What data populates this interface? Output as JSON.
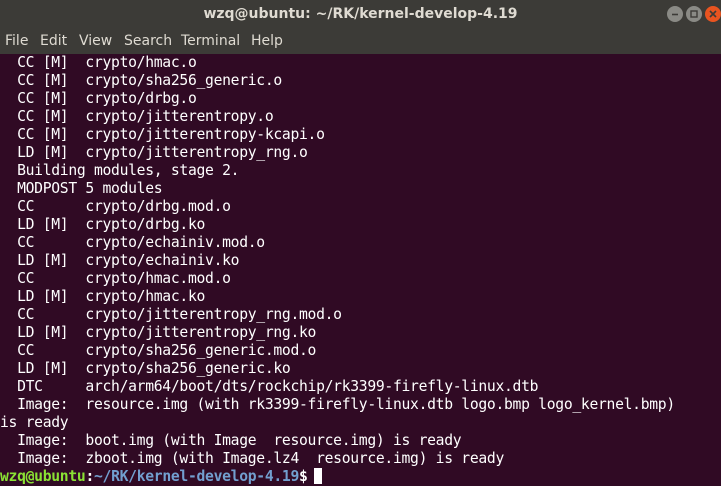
{
  "window": {
    "title": "wzq@ubuntu: ~/RK/kernel-develop-4.19",
    "controls": [
      "minimize",
      "maximize",
      "close"
    ]
  },
  "menu": {
    "file": "File",
    "edit": "Edit",
    "view": "View",
    "search": "Search",
    "terminal": "Terminal",
    "help": "Help"
  },
  "output_lines": [
    "  CC [M]  crypto/hmac.o",
    "  CC [M]  crypto/sha256_generic.o",
    "  CC [M]  crypto/drbg.o",
    "  CC [M]  crypto/jitterentropy.o",
    "  CC [M]  crypto/jitterentropy-kcapi.o",
    "  LD [M]  crypto/jitterentropy_rng.o",
    "  Building modules, stage 2.",
    "  MODPOST 5 modules",
    "  CC      crypto/drbg.mod.o",
    "  LD [M]  crypto/drbg.ko",
    "  CC      crypto/echainiv.mod.o",
    "  LD [M]  crypto/echainiv.ko",
    "  CC      crypto/hmac.mod.o",
    "  LD [M]  crypto/hmac.ko",
    "  CC      crypto/jitterentropy_rng.mod.o",
    "  LD [M]  crypto/jitterentropy_rng.ko",
    "  CC      crypto/sha256_generic.mod.o",
    "  LD [M]  crypto/sha256_generic.ko",
    "  DTC     arch/arm64/boot/dts/rockchip/rk3399-firefly-linux.dtb",
    "  Image:  resource.img (with rk3399-firefly-linux.dtb logo.bmp logo_kernel.bmp)",
    "is ready",
    "  Image:  boot.img (with Image  resource.img) is ready",
    "  Image:  zboot.img (with Image.lz4  resource.img) is ready"
  ],
  "prompt": {
    "user_host": "wzq@ubuntu",
    "separator": ":",
    "path": "~/RK/kernel-develop-4.19",
    "symbol": "$"
  },
  "colors": {
    "background": "#300a24",
    "titlebar": "#3c3b37",
    "text": "#ffffff",
    "prompt_user": "#8ae234",
    "prompt_path": "#729fcf",
    "close_button": "#e95420"
  }
}
